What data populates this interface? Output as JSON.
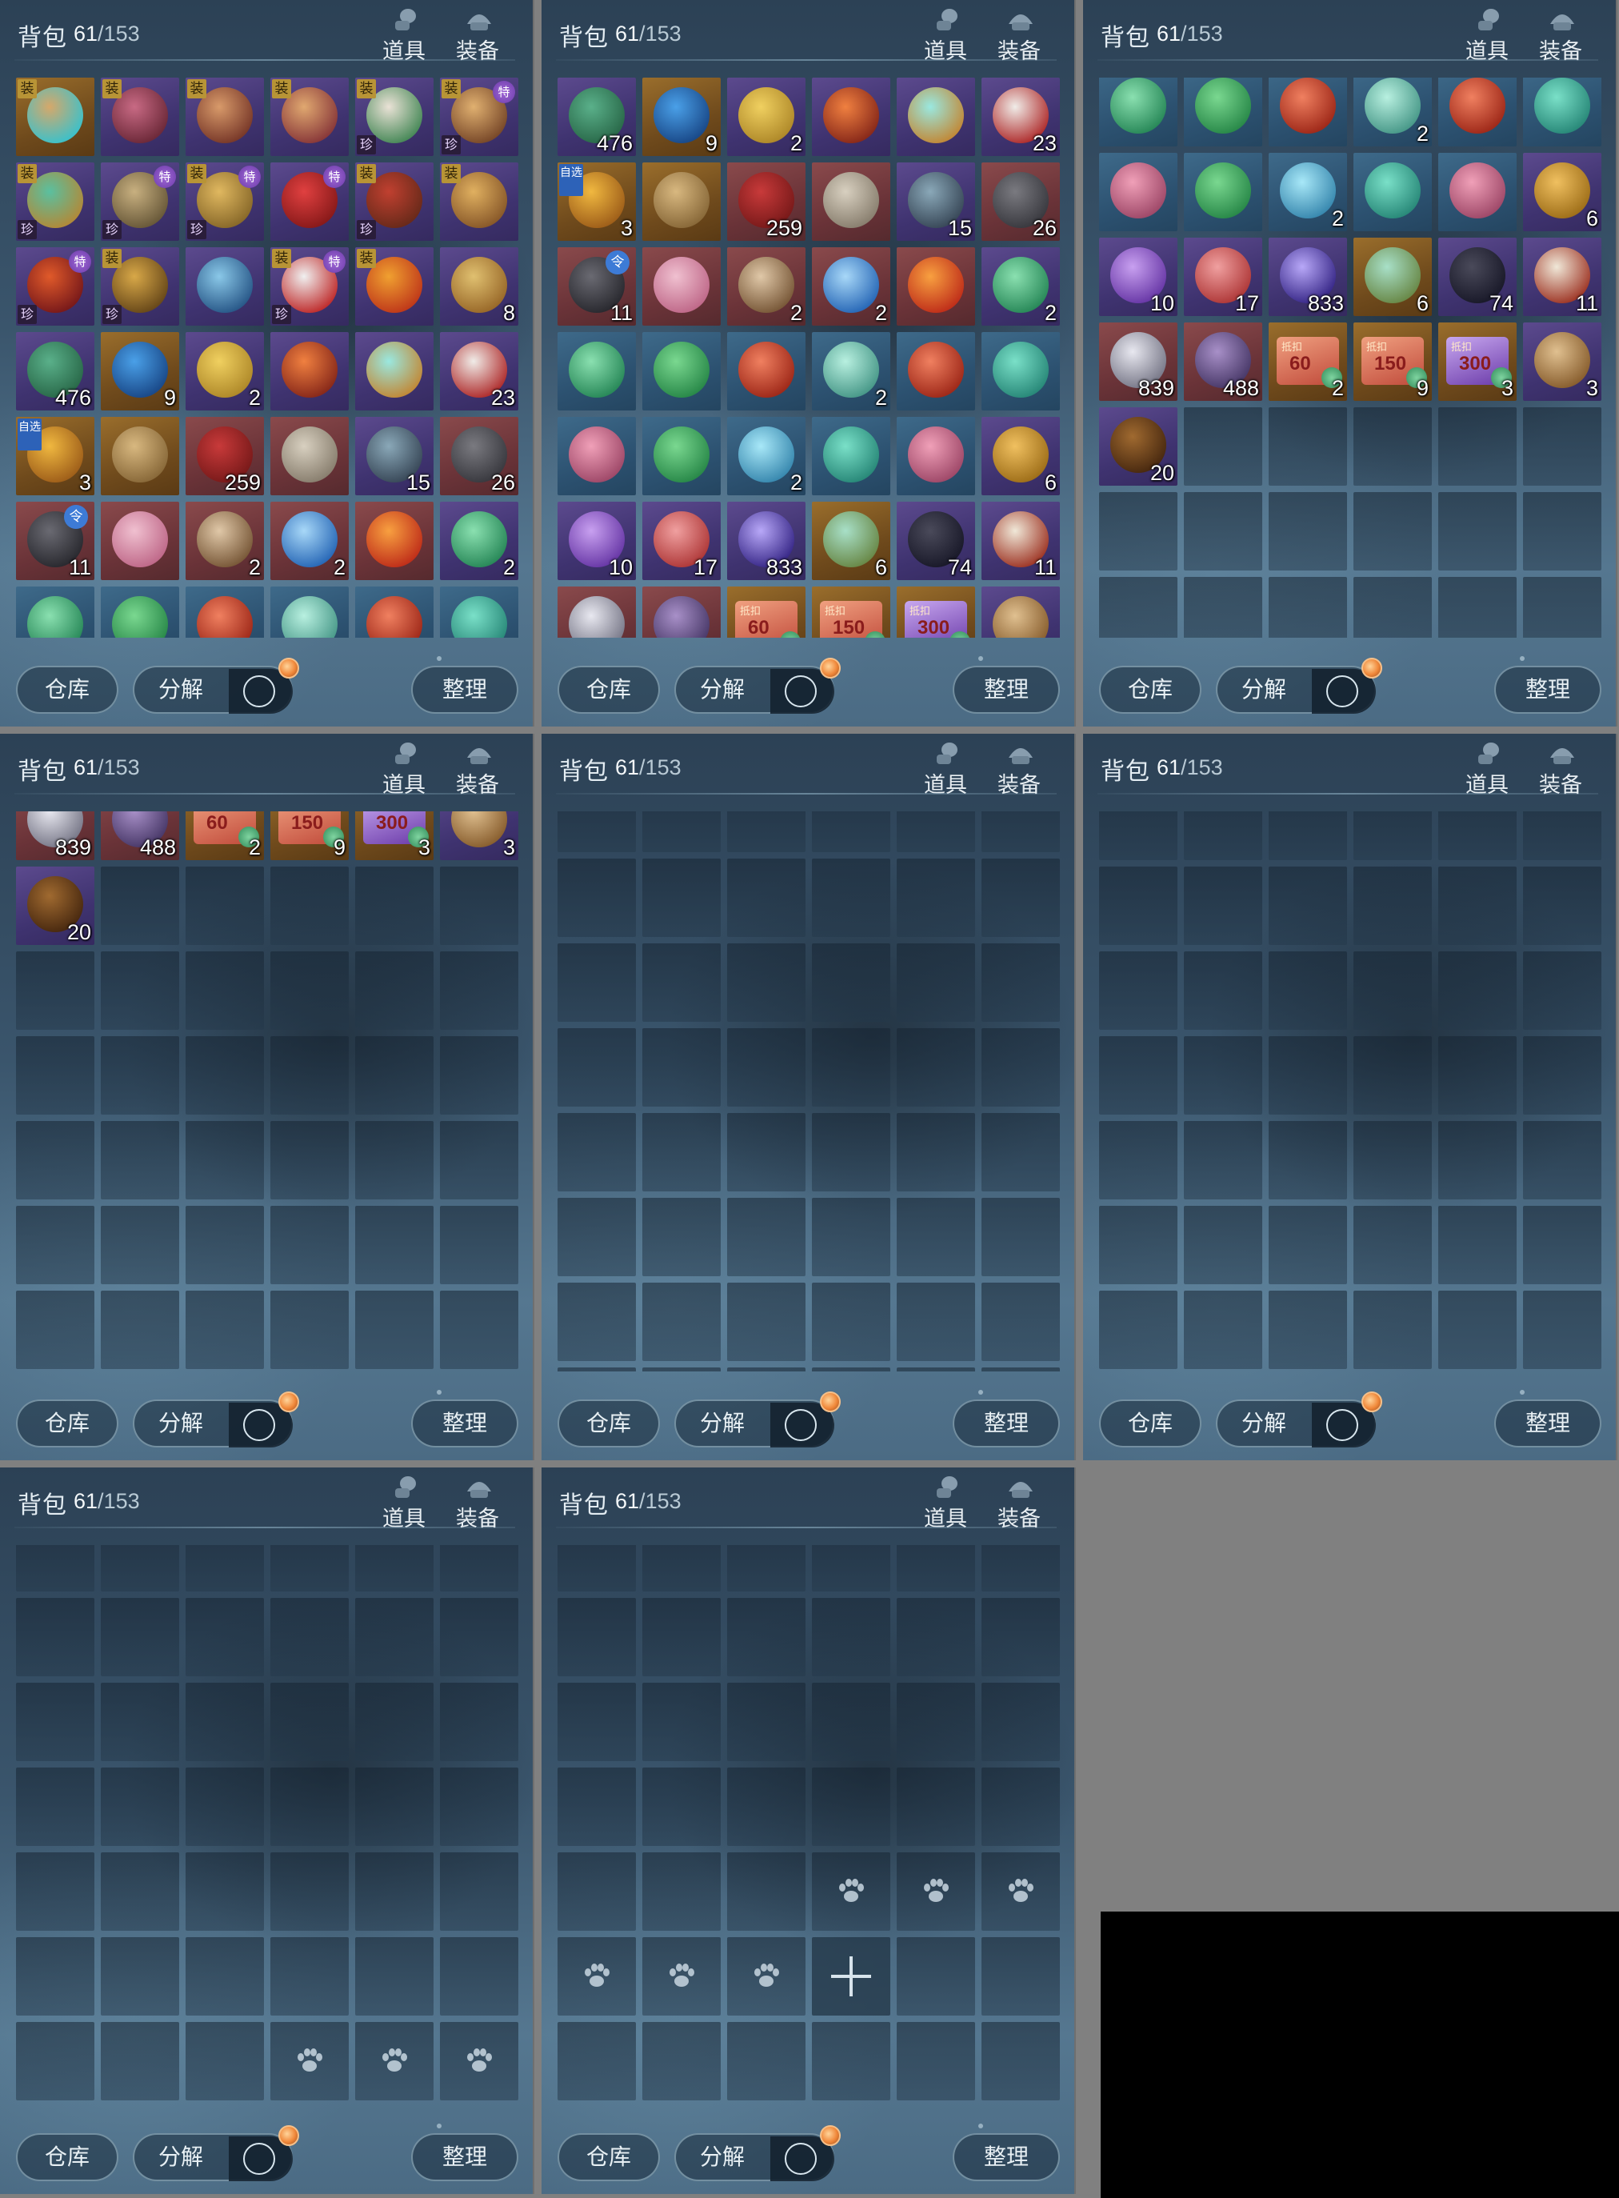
{
  "header": {
    "title": "背包",
    "count_current": "61",
    "count_separator": "/",
    "count_capacity": "153",
    "tab_items": "道具",
    "tab_equipment": "装备"
  },
  "footer": {
    "warehouse": "仓库",
    "decompose": "分解",
    "sort": "整理"
  },
  "badges": {
    "equip": "装",
    "rare": "珍",
    "special": "特",
    "optional": "自选",
    "token": "令",
    "voucher": "抵扣"
  },
  "colors": {
    "purple": "#4a3c7e",
    "gold": "#7a5422",
    "red": "#6e3a3e",
    "blue": "#2f5575",
    "notification": "#f0883a",
    "hammer_icon": "#d8e6ee"
  },
  "items": [
    {
      "icon": "ring-icon",
      "rarity": "gold",
      "qty": "",
      "c1": "#d6a86a",
      "c2": "#3fc0c8",
      "badges": [
        "equip"
      ]
    },
    {
      "icon": "boots-icon",
      "rarity": "purple",
      "qty": "",
      "c1": "#c86a84",
      "c2": "#6e2a3a",
      "badges": [
        "equip"
      ]
    },
    {
      "icon": "bracelet-icon",
      "rarity": "purple",
      "qty": "",
      "c1": "#d89a6a",
      "c2": "#7a3a2a",
      "badges": [
        "equip"
      ]
    },
    {
      "icon": "bangle-icon",
      "rarity": "purple",
      "qty": "",
      "c1": "#e0a870",
      "c2": "#8a3a3a",
      "badges": [
        "equip"
      ]
    },
    {
      "icon": "pearl-ring-icon",
      "rarity": "purple",
      "qty": "",
      "c1": "#eae2d6",
      "c2": "#4a8a5a",
      "badges": [
        "equip",
        "rare"
      ]
    },
    {
      "icon": "claw-icon",
      "rarity": "purple",
      "qty": "",
      "c1": "#e0b070",
      "c2": "#7a4a2a",
      "badges": [
        "equip",
        "special",
        "rare"
      ]
    },
    {
      "icon": "necklace-icon",
      "rarity": "purple",
      "qty": "",
      "c1": "#5ac0a0",
      "c2": "#b08a3a",
      "badges": [
        "equip",
        "rare"
      ]
    },
    {
      "icon": "beast-figure-icon",
      "rarity": "purple",
      "qty": "",
      "c1": "#c8b080",
      "c2": "#6a5a3a",
      "badges": [
        "special",
        "rare"
      ]
    },
    {
      "icon": "gold-necklace-icon",
      "rarity": "purple",
      "qty": "",
      "c1": "#e0b860",
      "c2": "#8a6a2a",
      "badges": [
        "equip",
        "special",
        "rare"
      ]
    },
    {
      "icon": "red-candle-icon",
      "rarity": "purple",
      "qty": "",
      "c1": "#e04040",
      "c2": "#8a1a1a",
      "badges": [
        "special"
      ]
    },
    {
      "icon": "belt-icon",
      "rarity": "purple",
      "qty": "",
      "c1": "#c04030",
      "c2": "#6a2a1a",
      "badges": [
        "equip",
        "rare"
      ]
    },
    {
      "icon": "gauntlet-icon",
      "rarity": "purple",
      "qty": "",
      "c1": "#e0b060",
      "c2": "#8a5a2a",
      "badges": [
        "equip"
      ]
    },
    {
      "icon": "flame-armor-icon",
      "rarity": "purple",
      "qty": "",
      "c1": "#e05a2a",
      "c2": "#7a1a1a",
      "badges": [
        "special",
        "rare"
      ]
    },
    {
      "icon": "golden-glove-icon",
      "rarity": "purple",
      "qty": "",
      "c1": "#d8a848",
      "c2": "#6a4a1a",
      "badges": [
        "equip",
        "rare"
      ]
    },
    {
      "icon": "blue-blade-icon",
      "rarity": "purple",
      "qty": "",
      "c1": "#8ac8e8",
      "c2": "#2a5a8a",
      "badges": []
    },
    {
      "icon": "mushroom-icon",
      "rarity": "purple",
      "qty": "",
      "c1": "#f0f0f0",
      "c2": "#c03030",
      "badges": [
        "equip",
        "special",
        "rare"
      ]
    },
    {
      "icon": "sun-amulet-icon",
      "rarity": "purple",
      "qty": "",
      "c1": "#f0a030",
      "c2": "#c03a1a",
      "badges": [
        "equip"
      ]
    },
    {
      "icon": "scroll-icon",
      "rarity": "purple",
      "qty": "8",
      "c1": "#e0c070",
      "c2": "#9a6a2a",
      "badges": []
    },
    {
      "icon": "jade-seal-icon",
      "rarity": "purple",
      "qty": "476",
      "c1": "#5ab08a",
      "c2": "#2a6a4a",
      "badges": []
    },
    {
      "icon": "blue-crystal-icon",
      "rarity": "gold",
      "qty": "9",
      "c1": "#4aa0e8",
      "c2": "#1a4a8a",
      "badges": []
    },
    {
      "icon": "gold-pile-icon",
      "rarity": "purple",
      "qty": "2",
      "c1": "#f0d060",
      "c2": "#b08a2a",
      "badges": []
    },
    {
      "icon": "red-orb-icon",
      "rarity": "purple",
      "qty": "",
      "c1": "#f08040",
      "c2": "#8a2a1a",
      "badges": []
    },
    {
      "icon": "teal-orb-icon",
      "rarity": "purple",
      "qty": "",
      "c1": "#9ae8e0",
      "c2": "#c08a3a",
      "badges": []
    },
    {
      "icon": "gourd-icon",
      "rarity": "purple",
      "qty": "23",
      "c1": "#f0ece8",
      "c2": "#b03030",
      "badges": []
    },
    {
      "icon": "gold-chest-icon",
      "rarity": "gold",
      "qty": "3",
      "c1": "#f0b840",
      "c2": "#a0601a",
      "badges": [
        "optional"
      ]
    },
    {
      "icon": "manual-book-icon",
      "rarity": "gold",
      "qty": "",
      "c1": "#d8b880",
      "c2": "#8a6a3a",
      "badges": []
    },
    {
      "icon": "red-pouch-icon",
      "rarity": "red",
      "qty": "259",
      "c1": "#c83a3a",
      "c2": "#7a1a1a",
      "badges": []
    },
    {
      "icon": "ore-rock-icon",
      "rarity": "red",
      "qty": "",
      "c1": "#d8d0c0",
      "c2": "#8a8070",
      "badges": []
    },
    {
      "icon": "dark-crystal-icon",
      "rarity": "purple",
      "qty": "15",
      "c1": "#8aa8b8",
      "c2": "#3a4a5a",
      "badges": []
    },
    {
      "icon": "grey-ore-icon",
      "rarity": "red",
      "qty": "26",
      "c1": "#7a7a80",
      "c2": "#3a3a40",
      "badges": []
    },
    {
      "icon": "iron-ore-icon",
      "rarity": "red",
      "qty": "11",
      "c1": "#6a6a72",
      "c2": "#2a2a30",
      "badges": [
        "token"
      ]
    },
    {
      "icon": "lotus-icon",
      "rarity": "red",
      "qty": "",
      "c1": "#f0c0d0",
      "c2": "#c06a8a",
      "badges": []
    },
    {
      "icon": "spear-icon",
      "rarity": "red",
      "qty": "2",
      "c1": "#e0c8a8",
      "c2": "#7a5a3a",
      "badges": []
    },
    {
      "icon": "water-drop-icon",
      "rarity": "red",
      "qty": "2",
      "c1": "#a8d8f8",
      "c2": "#2a6ab8",
      "badges": []
    },
    {
      "icon": "fire-essence-icon",
      "rarity": "red",
      "qty": "",
      "c1": "#f8a040",
      "c2": "#c0301a",
      "badges": []
    },
    {
      "icon": "green-swirl-icon",
      "rarity": "purple",
      "qty": "2",
      "c1": "#8ae0b0",
      "c2": "#2a8a5a",
      "badges": []
    },
    {
      "icon": "green-swirl-icon",
      "rarity": "blue",
      "qty": "",
      "c1": "#8ae0b0",
      "c2": "#2a8a5a",
      "badges": []
    },
    {
      "icon": "green-jade-icon",
      "rarity": "blue",
      "qty": "",
      "c1": "#7ad890",
      "c2": "#2a8a4a",
      "badges": []
    },
    {
      "icon": "red-jade-icon",
      "rarity": "blue",
      "qty": "",
      "c1": "#f08060",
      "c2": "#a02a1a",
      "badges": []
    },
    {
      "icon": "pale-jade-icon",
      "rarity": "blue",
      "qty": "2",
      "c1": "#b8f0e0",
      "c2": "#4a9a8a",
      "badges": []
    },
    {
      "icon": "red-jade-icon",
      "rarity": "blue",
      "qty": "",
      "c1": "#f08060",
      "c2": "#a02a1a",
      "badges": []
    },
    {
      "icon": "teal-jade-icon",
      "rarity": "blue",
      "qty": "",
      "c1": "#7ae0c8",
      "c2": "#2a8a7a",
      "badges": []
    },
    {
      "icon": "pink-jade-icon",
      "rarity": "blue",
      "qty": "",
      "c1": "#f0a0b8",
      "c2": "#a04a6a",
      "badges": []
    },
    {
      "icon": "green-jade-icon",
      "rarity": "blue",
      "qty": "",
      "c1": "#7ad890",
      "c2": "#2a8a4a",
      "badges": []
    },
    {
      "icon": "cyan-jade-icon",
      "rarity": "blue",
      "qty": "2",
      "c1": "#a8e8f8",
      "c2": "#3a8ab0",
      "badges": []
    },
    {
      "icon": "teal-jade-icon",
      "rarity": "blue",
      "qty": "",
      "c1": "#7ae0c8",
      "c2": "#2a8a7a",
      "badges": []
    },
    {
      "icon": "pink-jade-icon",
      "rarity": "blue",
      "qty": "",
      "c1": "#f0a0b8",
      "c2": "#a04a6a",
      "badges": []
    },
    {
      "icon": "gold-tablet-icon",
      "rarity": "purple",
      "qty": "6",
      "c1": "#f0c060",
      "c2": "#a0701a",
      "badges": []
    },
    {
      "icon": "purple-talisman-icon",
      "rarity": "purple",
      "qty": "10",
      "c1": "#c8a0f0",
      "c2": "#6a3aa8",
      "badges": []
    },
    {
      "icon": "red-talisman-icon",
      "rarity": "purple",
      "qty": "17",
      "c1": "#f0a0a0",
      "c2": "#b03a3a",
      "badges": []
    },
    {
      "icon": "vortex-icon",
      "rarity": "purple",
      "qty": "833",
      "c1": "#b8a8f8",
      "c2": "#3a2a8a",
      "badges": []
    },
    {
      "icon": "jade-scroll-icon",
      "rarity": "gold",
      "qty": "6",
      "c1": "#a8e0c8",
      "c2": "#6a8a4a",
      "badges": []
    },
    {
      "icon": "black-banner-icon",
      "rarity": "purple",
      "qty": "74",
      "c1": "#4a4a5a",
      "c2": "#1a1a2a",
      "badges": []
    },
    {
      "icon": "book-stack-icon",
      "rarity": "purple",
      "qty": "11",
      "c1": "#f0e8d8",
      "c2": "#a03a2a",
      "badges": []
    },
    {
      "icon": "silver-ingot-icon",
      "rarity": "red",
      "qty": "839",
      "c1": "#e8e8f0",
      "c2": "#7a7a8a",
      "badges": []
    },
    {
      "icon": "purple-dish-icon",
      "rarity": "red",
      "qty": "488",
      "c1": "#a890c8",
      "c2": "#4a3a6a",
      "badges": []
    },
    {
      "icon": "voucher-60-icon",
      "rarity": "gold",
      "qty": "2",
      "c1": "#f0a080",
      "c2": "#c04a3a",
      "badges": [
        "voucher"
      ],
      "voucher_value": "60"
    },
    {
      "icon": "voucher-150-icon",
      "rarity": "gold",
      "qty": "9",
      "c1": "#f0a080",
      "c2": "#c04a3a",
      "badges": [
        "voucher"
      ],
      "voucher_value": "150"
    },
    {
      "icon": "voucher-300-icon",
      "rarity": "gold",
      "qty": "3",
      "c1": "#c8a8f0",
      "c2": "#6a3aa8",
      "badges": [
        "voucher"
      ],
      "voucher_value": "300"
    },
    {
      "icon": "wooden-plaque-icon",
      "rarity": "purple",
      "qty": "3",
      "c1": "#e0c090",
      "c2": "#8a6030",
      "badges": []
    },
    {
      "icon": "mystery-box-icon",
      "rarity": "purple",
      "qty": "20",
      "c1": "#a06a30",
      "c2": "#4a2a10",
      "badges": []
    }
  ],
  "slots": {
    "pet_icon": "paw-icon",
    "add_icon": "plus-icon"
  }
}
